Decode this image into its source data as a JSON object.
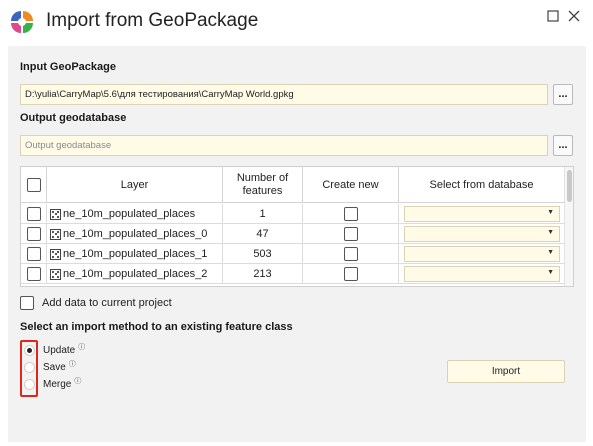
{
  "window": {
    "title": "Import from GeoPackage",
    "logo_colors": [
      "#3b63c4",
      "#f08a24",
      "#e04a8c",
      "#35b24a"
    ]
  },
  "input": {
    "label": "Input GeoPackage",
    "value": "D:\\yulia\\CarryMap\\5.6\\для тестирования\\CarryMap World.gpkg",
    "browse_label": "..."
  },
  "output": {
    "label": "Output geodatabase",
    "value": "",
    "placeholder": "Output geodatabase",
    "browse_label": "..."
  },
  "table": {
    "columns": [
      "",
      "Layer",
      "Number of features",
      "Create new",
      "Select from database"
    ],
    "rows": [
      {
        "layer": "ne_10m_populated_places",
        "features": "1"
      },
      {
        "layer": "ne_10m_populated_places_0",
        "features": "47"
      },
      {
        "layer": "ne_10m_populated_places_1",
        "features": "503"
      },
      {
        "layer": "ne_10m_populated_places_2",
        "features": "213"
      }
    ]
  },
  "add_to_project": {
    "label": "Add data to current project"
  },
  "import_method": {
    "label": "Select an import method to an existing feature class",
    "options": [
      {
        "label": "Update",
        "selected": true
      },
      {
        "label": "Save",
        "selected": false
      },
      {
        "label": "Merge",
        "selected": false
      }
    ],
    "info_glyph": "ⓘ"
  },
  "actions": {
    "import_label": "Import"
  },
  "colors": {
    "field_bg": "#fffbe6",
    "panel_bg": "#f2f2f2",
    "highlight": "#e0251b"
  }
}
